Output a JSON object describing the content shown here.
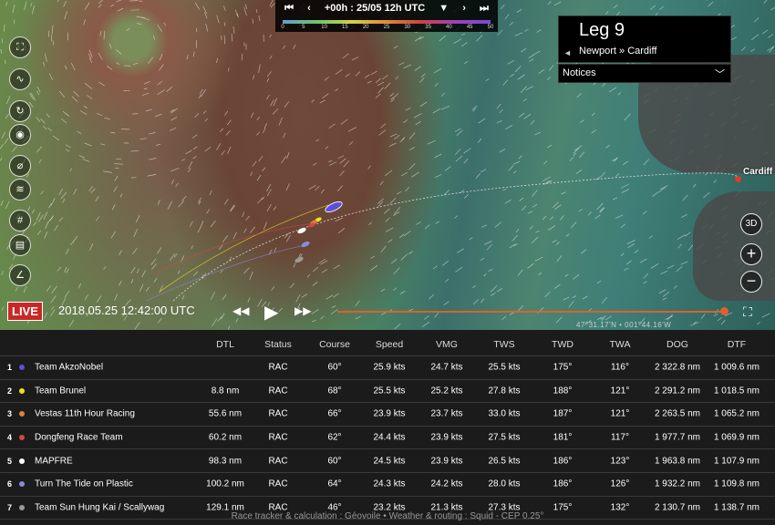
{
  "timebar": {
    "first_icon": "skip-first-icon",
    "prev_icon": "previous-icon",
    "label": "+00h : 25/05 12h UTC",
    "dropdown_icon": "caret-down-icon",
    "next_icon": "next-icon",
    "last_icon": "skip-last-icon",
    "scale_labels": [
      "0",
      "5",
      "10",
      "15",
      "20",
      "25",
      "30",
      "35",
      "40",
      "45",
      "50"
    ]
  },
  "leg": {
    "title": "Leg 9",
    "route": "Newport » Cardiff",
    "arrow": "◄"
  },
  "notices": {
    "label": "Notices",
    "chevron": "﹀"
  },
  "map": {
    "city_label": "Cardiff",
    "view3d": "3D",
    "zoom_in": "+",
    "zoom_out": "−",
    "coordinates": "47°31.17'N • 001°44.16'W"
  },
  "toolbar": [
    "book-icon",
    "route-icon",
    "track-icon",
    "location-icon",
    "compass-icon",
    "wind-icon",
    "grid-icon",
    "keyboard-icon",
    "chart-icon"
  ],
  "toolbar_glyphs": [
    "⛶",
    "∿",
    "↻",
    "◉",
    "⌀",
    "≋",
    "#",
    "▤",
    "∠"
  ],
  "playback": {
    "live": "LIVE",
    "datetime": "2018.05.25 12:42:00 UTC",
    "rewind": "◀◀",
    "play": "▶",
    "forward": "▶▶",
    "fullscreen": "⛶",
    "progress_fraction": 1.0
  },
  "table": {
    "headers": {
      "dtl": "DTL",
      "status": "Status",
      "course": "Course",
      "speed": "Speed",
      "vmg": "VMG",
      "tws": "TWS",
      "twd": "TWD",
      "twa": "TWA",
      "dog": "DOG",
      "dtf": "DTF"
    },
    "rows": [
      {
        "rank": "1",
        "color": "#5a4fd8",
        "name": "Team AkzoNobel",
        "dtl": "",
        "status": "RAC",
        "course": "60°",
        "speed": "25.9 kts",
        "vmg": "24.7 kts",
        "tws": "25.5 kts",
        "twd": "175°",
        "twa": "116°",
        "dog": "2 322.8 nm",
        "dtf": "1 009.6 nm"
      },
      {
        "rank": "2",
        "color": "#f0e020",
        "name": "Team Brunel",
        "dtl": "8.8 nm",
        "status": "RAC",
        "course": "68°",
        "speed": "25.5 kts",
        "vmg": "25.2 kts",
        "tws": "27.8 kts",
        "twd": "188°",
        "twa": "121°",
        "dog": "2 291.2 nm",
        "dtf": "1 018.5 nm"
      },
      {
        "rank": "3",
        "color": "#e0803a",
        "name": "Vestas 11th Hour Racing",
        "dtl": "55.6 nm",
        "status": "RAC",
        "course": "66°",
        "speed": "23.9 kts",
        "vmg": "23.7 kts",
        "tws": "33.0 kts",
        "twd": "187°",
        "twa": "121°",
        "dog": "2 263.5 nm",
        "dtf": "1 065.2 nm"
      },
      {
        "rank": "4",
        "color": "#d04848",
        "name": "Dongfeng Race Team",
        "dtl": "60.2 nm",
        "status": "RAC",
        "course": "62°",
        "speed": "24.4 kts",
        "vmg": "23.9 kts",
        "tws": "27.5 kts",
        "twd": "181°",
        "twa": "117°",
        "dog": "1 977.7 nm",
        "dtf": "1 069.9 nm"
      },
      {
        "rank": "5",
        "color": "#ffffff",
        "name": "MAPFRE",
        "dtl": "98.3 nm",
        "status": "RAC",
        "course": "60°",
        "speed": "24.5 kts",
        "vmg": "23.9 kts",
        "tws": "26.5 kts",
        "twd": "186°",
        "twa": "123°",
        "dog": "1 963.8 nm",
        "dtf": "1 107.9 nm"
      },
      {
        "rank": "6",
        "color": "#8a8ad8",
        "name": "Turn The Tide on Plastic",
        "dtl": "100.2 nm",
        "status": "RAC",
        "course": "64°",
        "speed": "24.3 kts",
        "vmg": "24.2 kts",
        "tws": "28.0 kts",
        "twd": "186°",
        "twa": "126°",
        "dog": "1 932.2 nm",
        "dtf": "1 109.8 nm"
      },
      {
        "rank": "7",
        "color": "#9a9a9a",
        "name": "Team Sun Hung Kai / Scallywag",
        "dtl": "129.1 nm",
        "status": "RAC",
        "course": "46°",
        "speed": "23.2 kts",
        "vmg": "21.3 kts",
        "tws": "27.3 kts",
        "twd": "175°",
        "twa": "132°",
        "dog": "2 130.7 nm",
        "dtf": "1 138.7 nm"
      }
    ]
  },
  "footer": "Race tracker & calculation : Géovoile • Weather & routing : Squid - CEP 0.25°"
}
